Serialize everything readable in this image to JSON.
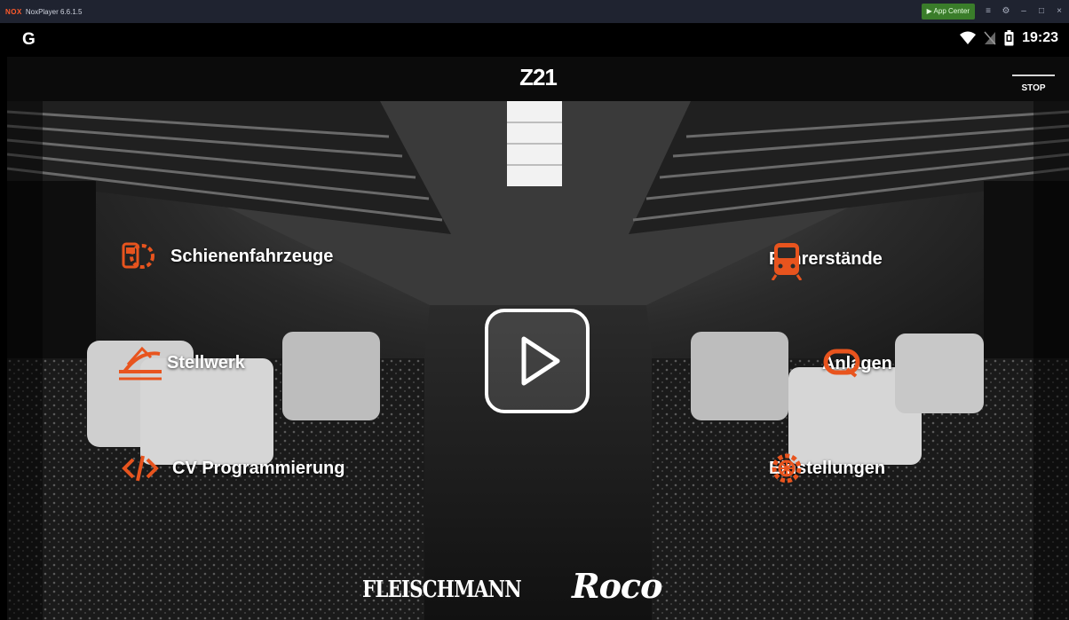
{
  "emulator": {
    "logo": "NOX",
    "title": "NoxPlayer 6.6.1.5",
    "app_center": "App Center"
  },
  "status_bar": {
    "google_logo": "G",
    "time": "19:23",
    "icons": [
      "wifi-icon",
      "no-sim-icon",
      "battery-icon"
    ]
  },
  "app_bar": {
    "title": "Z21",
    "stop_label": "STOP"
  },
  "menu": {
    "left": [
      {
        "label": "Schienenfahrzeuge",
        "icon": "locomotive-gear-icon"
      },
      {
        "label": "Stellwerk",
        "icon": "track-switch-icon"
      },
      {
        "label": "CV Programmierung",
        "icon": "code-icon"
      }
    ],
    "right": [
      {
        "label": "Führerstände",
        "icon": "train-front-icon"
      },
      {
        "label": "Anlagen",
        "icon": "track-loop-icon"
      },
      {
        "label": "Einstellungen",
        "icon": "gear-icon"
      }
    ]
  },
  "brands": {
    "fleischmann": "FLEISCHMANN",
    "roco": "Roco"
  },
  "colors": {
    "accent": "#e8541e",
    "toolbar": "#0b0b0b",
    "emulator_bar": "#1f2330",
    "app_center": "#3a7d2a"
  }
}
